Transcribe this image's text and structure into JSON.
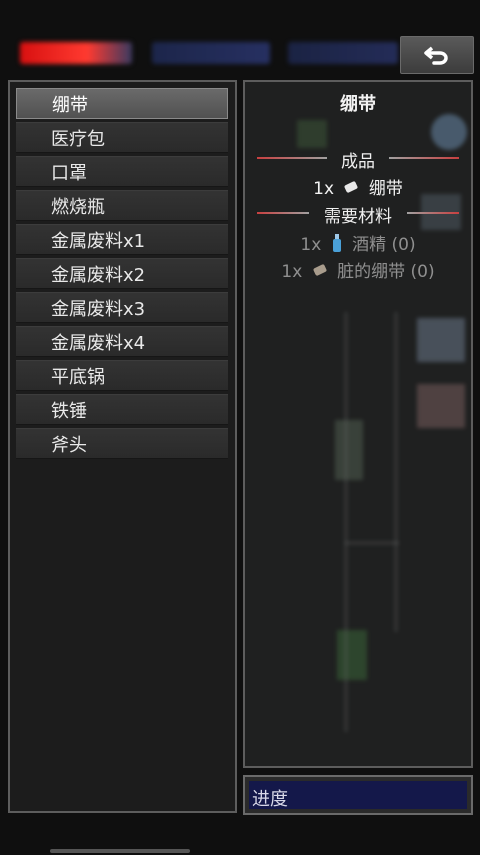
{
  "left_list": {
    "items": [
      "绷带",
      "医疗包",
      "口罩",
      "燃烧瓶",
      "金属废料x1",
      "金属废料x2",
      "金属废料x3",
      "金属废料x4",
      "平底锅",
      "铁锤",
      "斧头"
    ],
    "selected_index": 0
  },
  "detail": {
    "title": "绷带",
    "product_header": "成品",
    "product": {
      "qty": "1x",
      "name": "绷带",
      "icon": "bandage-icon"
    },
    "materials_header": "需要材料",
    "materials": [
      {
        "qty": "1x",
        "name": "酒精 (0)",
        "icon": "alcohol-bottle-icon"
      },
      {
        "qty": "1x",
        "name": "脏的绷带 (0)",
        "icon": "dirty-bandage-icon"
      }
    ]
  },
  "progress": {
    "label": "进度",
    "value": 0
  },
  "colors": {
    "accent_line": "#c84040",
    "progress_bg": "#14184a",
    "health_bar": "#d81010"
  }
}
